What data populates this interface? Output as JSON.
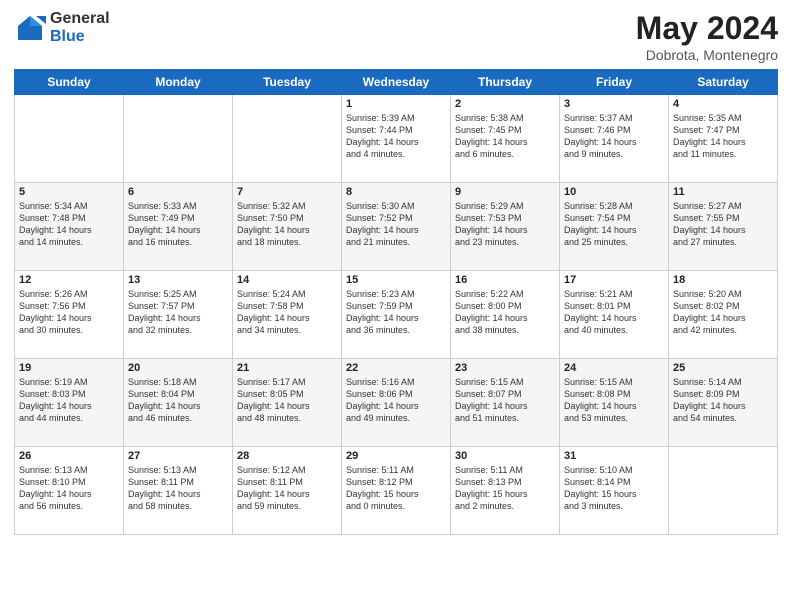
{
  "header": {
    "logo_general": "General",
    "logo_blue": "Blue",
    "main_title": "May 2024",
    "subtitle": "Dobrota, Montenegro"
  },
  "days_of_week": [
    "Sunday",
    "Monday",
    "Tuesday",
    "Wednesday",
    "Thursday",
    "Friday",
    "Saturday"
  ],
  "weeks": [
    [
      {
        "day": "",
        "info": ""
      },
      {
        "day": "",
        "info": ""
      },
      {
        "day": "",
        "info": ""
      },
      {
        "day": "1",
        "info": "Sunrise: 5:39 AM\nSunset: 7:44 PM\nDaylight: 14 hours\nand 4 minutes."
      },
      {
        "day": "2",
        "info": "Sunrise: 5:38 AM\nSunset: 7:45 PM\nDaylight: 14 hours\nand 6 minutes."
      },
      {
        "day": "3",
        "info": "Sunrise: 5:37 AM\nSunset: 7:46 PM\nDaylight: 14 hours\nand 9 minutes."
      },
      {
        "day": "4",
        "info": "Sunrise: 5:35 AM\nSunset: 7:47 PM\nDaylight: 14 hours\nand 11 minutes."
      }
    ],
    [
      {
        "day": "5",
        "info": "Sunrise: 5:34 AM\nSunset: 7:48 PM\nDaylight: 14 hours\nand 14 minutes."
      },
      {
        "day": "6",
        "info": "Sunrise: 5:33 AM\nSunset: 7:49 PM\nDaylight: 14 hours\nand 16 minutes."
      },
      {
        "day": "7",
        "info": "Sunrise: 5:32 AM\nSunset: 7:50 PM\nDaylight: 14 hours\nand 18 minutes."
      },
      {
        "day": "8",
        "info": "Sunrise: 5:30 AM\nSunset: 7:52 PM\nDaylight: 14 hours\nand 21 minutes."
      },
      {
        "day": "9",
        "info": "Sunrise: 5:29 AM\nSunset: 7:53 PM\nDaylight: 14 hours\nand 23 minutes."
      },
      {
        "day": "10",
        "info": "Sunrise: 5:28 AM\nSunset: 7:54 PM\nDaylight: 14 hours\nand 25 minutes."
      },
      {
        "day": "11",
        "info": "Sunrise: 5:27 AM\nSunset: 7:55 PM\nDaylight: 14 hours\nand 27 minutes."
      }
    ],
    [
      {
        "day": "12",
        "info": "Sunrise: 5:26 AM\nSunset: 7:56 PM\nDaylight: 14 hours\nand 30 minutes."
      },
      {
        "day": "13",
        "info": "Sunrise: 5:25 AM\nSunset: 7:57 PM\nDaylight: 14 hours\nand 32 minutes."
      },
      {
        "day": "14",
        "info": "Sunrise: 5:24 AM\nSunset: 7:58 PM\nDaylight: 14 hours\nand 34 minutes."
      },
      {
        "day": "15",
        "info": "Sunrise: 5:23 AM\nSunset: 7:59 PM\nDaylight: 14 hours\nand 36 minutes."
      },
      {
        "day": "16",
        "info": "Sunrise: 5:22 AM\nSunset: 8:00 PM\nDaylight: 14 hours\nand 38 minutes."
      },
      {
        "day": "17",
        "info": "Sunrise: 5:21 AM\nSunset: 8:01 PM\nDaylight: 14 hours\nand 40 minutes."
      },
      {
        "day": "18",
        "info": "Sunrise: 5:20 AM\nSunset: 8:02 PM\nDaylight: 14 hours\nand 42 minutes."
      }
    ],
    [
      {
        "day": "19",
        "info": "Sunrise: 5:19 AM\nSunset: 8:03 PM\nDaylight: 14 hours\nand 44 minutes."
      },
      {
        "day": "20",
        "info": "Sunrise: 5:18 AM\nSunset: 8:04 PM\nDaylight: 14 hours\nand 46 minutes."
      },
      {
        "day": "21",
        "info": "Sunrise: 5:17 AM\nSunset: 8:05 PM\nDaylight: 14 hours\nand 48 minutes."
      },
      {
        "day": "22",
        "info": "Sunrise: 5:16 AM\nSunset: 8:06 PM\nDaylight: 14 hours\nand 49 minutes."
      },
      {
        "day": "23",
        "info": "Sunrise: 5:15 AM\nSunset: 8:07 PM\nDaylight: 14 hours\nand 51 minutes."
      },
      {
        "day": "24",
        "info": "Sunrise: 5:15 AM\nSunset: 8:08 PM\nDaylight: 14 hours\nand 53 minutes."
      },
      {
        "day": "25",
        "info": "Sunrise: 5:14 AM\nSunset: 8:09 PM\nDaylight: 14 hours\nand 54 minutes."
      }
    ],
    [
      {
        "day": "26",
        "info": "Sunrise: 5:13 AM\nSunset: 8:10 PM\nDaylight: 14 hours\nand 56 minutes."
      },
      {
        "day": "27",
        "info": "Sunrise: 5:13 AM\nSunset: 8:11 PM\nDaylight: 14 hours\nand 58 minutes."
      },
      {
        "day": "28",
        "info": "Sunrise: 5:12 AM\nSunset: 8:11 PM\nDaylight: 14 hours\nand 59 minutes."
      },
      {
        "day": "29",
        "info": "Sunrise: 5:11 AM\nSunset: 8:12 PM\nDaylight: 15 hours\nand 0 minutes."
      },
      {
        "day": "30",
        "info": "Sunrise: 5:11 AM\nSunset: 8:13 PM\nDaylight: 15 hours\nand 2 minutes."
      },
      {
        "day": "31",
        "info": "Sunrise: 5:10 AM\nSunset: 8:14 PM\nDaylight: 15 hours\nand 3 minutes."
      },
      {
        "day": "",
        "info": ""
      }
    ]
  ]
}
